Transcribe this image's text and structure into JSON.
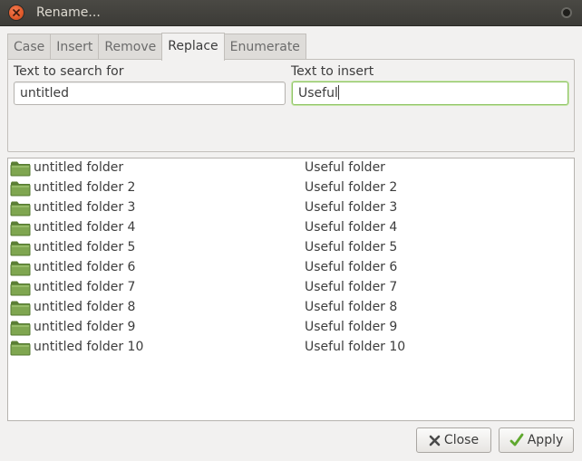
{
  "window": {
    "title": "Rename..."
  },
  "tabs": [
    {
      "label": "Case",
      "active": false
    },
    {
      "label": "Insert",
      "active": false
    },
    {
      "label": "Remove",
      "active": false
    },
    {
      "label": "Replace",
      "active": true
    },
    {
      "label": "Enumerate",
      "active": false
    }
  ],
  "replace_panel": {
    "search_label": "Text to search for",
    "search_value": "untitled",
    "insert_label": "Text to insert",
    "insert_value": "Useful"
  },
  "preview": [
    {
      "original": "untitled folder",
      "renamed": "Useful folder"
    },
    {
      "original": "untitled folder 2",
      "renamed": "Useful folder 2"
    },
    {
      "original": "untitled folder 3",
      "renamed": "Useful folder 3"
    },
    {
      "original": "untitled folder 4",
      "renamed": "Useful folder 4"
    },
    {
      "original": "untitled folder 5",
      "renamed": "Useful folder 5"
    },
    {
      "original": "untitled folder 6",
      "renamed": "Useful folder 6"
    },
    {
      "original": "untitled folder 7",
      "renamed": "Useful folder 7"
    },
    {
      "original": "untitled folder 8",
      "renamed": "Useful folder 8"
    },
    {
      "original": "untitled folder 9",
      "renamed": "Useful folder 9"
    },
    {
      "original": "untitled folder 10",
      "renamed": "Useful folder 10"
    }
  ],
  "buttons": {
    "close_label": "Close",
    "apply_label": "Apply"
  },
  "icons": {
    "folder": "folder-icon",
    "close": "close-x-icon",
    "apply": "checkmark-icon"
  },
  "colors": {
    "folder_fill": "#7fa650",
    "focus_border": "#8ec463",
    "titlebar": "#3c3b37",
    "close_button": "#e05a2a"
  }
}
